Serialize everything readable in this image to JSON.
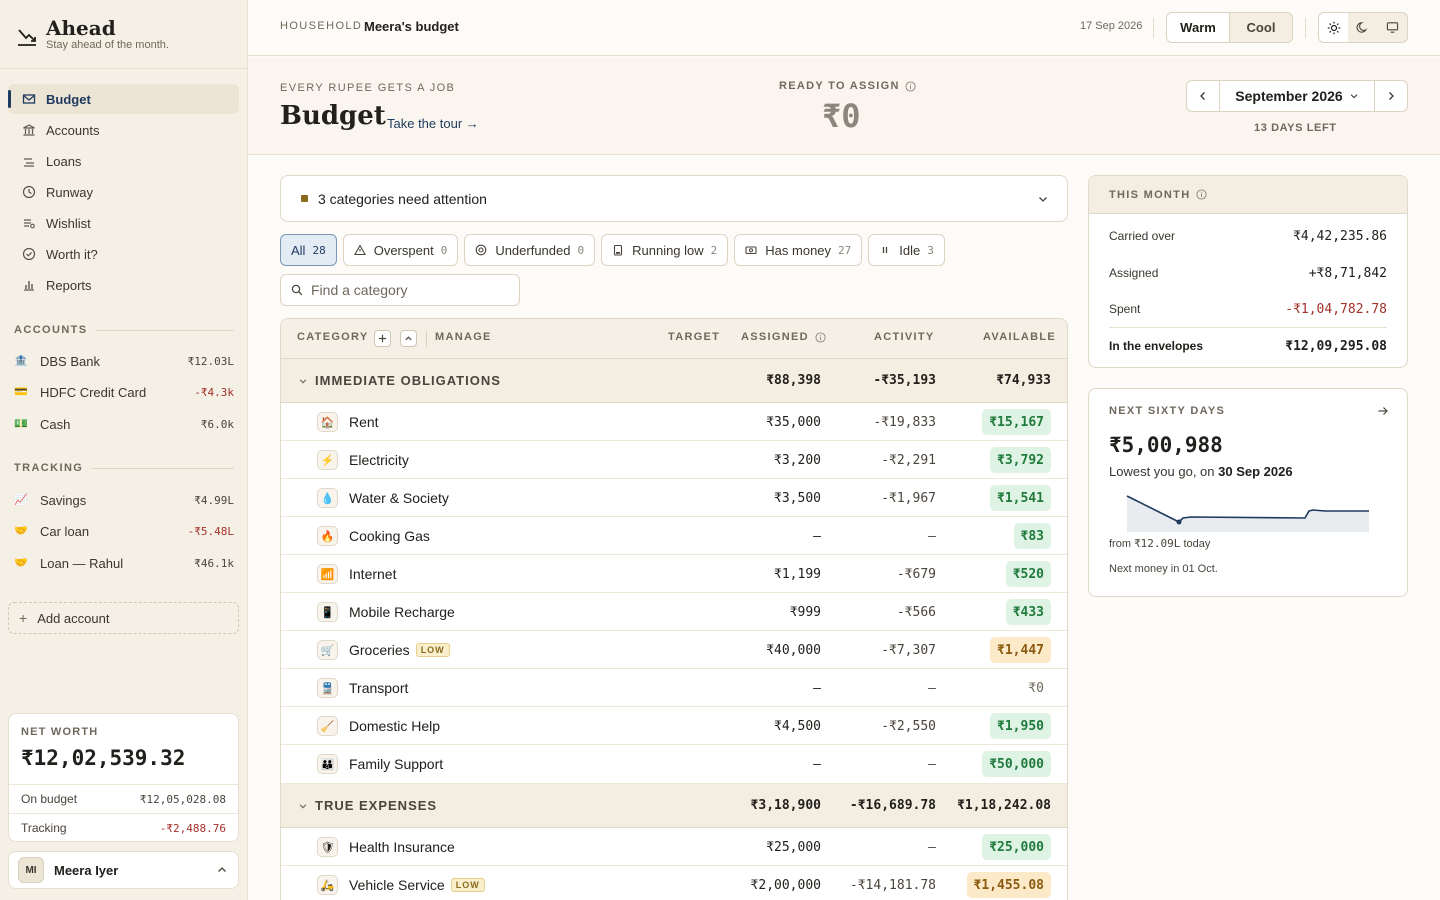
{
  "brand": {
    "title": "Ahead",
    "tagline": "Stay ahead of the month."
  },
  "nav": [
    {
      "label": "Budget",
      "icon": "envelope-icon",
      "active": true
    },
    {
      "label": "Accounts",
      "icon": "bank-icon"
    },
    {
      "label": "Loans",
      "icon": "transfer-icon"
    },
    {
      "label": "Runway",
      "icon": "clock-icon"
    },
    {
      "label": "Wishlist",
      "icon": "list-icon"
    },
    {
      "label": "Worth it?",
      "icon": "check-circle-icon"
    },
    {
      "label": "Reports",
      "icon": "bar-chart-icon"
    }
  ],
  "accounts": {
    "heading": "ACCOUNTS",
    "items": [
      {
        "name": "DBS Bank",
        "value": "₹12.03L",
        "icon": "🏦",
        "negative": false
      },
      {
        "name": "HDFC Credit Card",
        "value": "-₹4.3k",
        "icon": "💳",
        "negative": true
      },
      {
        "name": "Cash",
        "value": "₹6.0k",
        "icon": "💵",
        "negative": false
      }
    ]
  },
  "tracking": {
    "heading": "TRACKING",
    "items": [
      {
        "name": "Savings",
        "value": "₹4.99L",
        "icon": "📈",
        "negative": false
      },
      {
        "name": "Car loan",
        "value": "-₹5.48L",
        "icon": "🤝",
        "negative": true
      },
      {
        "name": "Loan — Rahul",
        "value": "₹46.1k",
        "icon": "🤝",
        "negative": false
      }
    ]
  },
  "add_account": "Add account",
  "networth": {
    "label": "NET WORTH",
    "value": "₹12,02,539.32",
    "on_budget_label": "On budget",
    "on_budget_value": "₹12,05,028.08",
    "tracking_label": "Tracking",
    "tracking_value": "-₹2,488.76"
  },
  "user": {
    "initials": "MI",
    "name": "Meera Iyer"
  },
  "topbar": {
    "household_label": "HOUSEHOLD",
    "household_name": "Meera's budget",
    "date": "17 Sep 2026",
    "theme_options": [
      "Warm",
      "Cool"
    ],
    "theme_selected": "Warm"
  },
  "header": {
    "eyebrow": "EVERY RUPEE GETS A JOB",
    "title": "Budget",
    "tour": "Take the tour →",
    "rta_label": "READY TO ASSIGN",
    "rta_value": "₹0",
    "month": "September 2026",
    "days_left": "13 DAYS LEFT"
  },
  "attention": "3 categories need attention",
  "filters": [
    {
      "label": "All",
      "count": "28",
      "active": true
    },
    {
      "label": "Overspent",
      "count": "0"
    },
    {
      "label": "Underfunded",
      "count": "0"
    },
    {
      "label": "Running low",
      "count": "2"
    },
    {
      "label": "Has money",
      "count": "27"
    },
    {
      "label": "Idle",
      "count": "3"
    }
  ],
  "search": {
    "placeholder": "Find a category"
  },
  "table": {
    "headers": {
      "category": "CATEGORY",
      "manage": "MANAGE",
      "target": "TARGET",
      "assigned": "ASSIGNED",
      "activity": "ACTIVITY",
      "available": "AVAILABLE"
    },
    "groups": [
      {
        "name": "IMMEDIATE OBLIGATIONS",
        "assigned": "₹88,398",
        "activity": "-₹35,193",
        "available": "₹74,933",
        "rows": [
          {
            "icon": "🏠",
            "name": "Rent",
            "assigned": "₹35,000",
            "activity": "-₹19,833",
            "available": "₹15,167",
            "status": "pos"
          },
          {
            "icon": "⚡",
            "name": "Electricity",
            "assigned": "₹3,200",
            "activity": "-₹2,291",
            "available": "₹3,792",
            "status": "pos"
          },
          {
            "icon": "💧",
            "name": "Water & Society",
            "assigned": "₹3,500",
            "activity": "-₹1,967",
            "available": "₹1,541",
            "status": "pos"
          },
          {
            "icon": "🔥",
            "name": "Cooking Gas",
            "assigned": "–",
            "activity": "–",
            "available": "₹83",
            "status": "pos"
          },
          {
            "icon": "📶",
            "name": "Internet",
            "assigned": "₹1,199",
            "activity": "-₹679",
            "available": "₹520",
            "status": "pos"
          },
          {
            "icon": "📱",
            "name": "Mobile Recharge",
            "assigned": "₹999",
            "activity": "-₹566",
            "available": "₹433",
            "status": "pos"
          },
          {
            "icon": "🛒",
            "name": "Groceries",
            "badge": "LOW",
            "assigned": "₹40,000",
            "activity": "-₹7,307",
            "available": "₹1,447",
            "status": "low"
          },
          {
            "icon": "🚆",
            "name": "Transport",
            "assigned": "–",
            "activity": "–",
            "available": "₹0",
            "status": "zero"
          },
          {
            "icon": "🧹",
            "name": "Domestic Help",
            "assigned": "₹4,500",
            "activity": "-₹2,550",
            "available": "₹1,950",
            "status": "pos"
          },
          {
            "icon": "👪",
            "name": "Family Support",
            "assigned": "–",
            "activity": "–",
            "available": "₹50,000",
            "status": "pos"
          }
        ]
      },
      {
        "name": "TRUE EXPENSES",
        "assigned": "₹3,18,900",
        "activity": "-₹16,689.78",
        "available": "₹1,18,242.08",
        "rows": [
          {
            "icon": "🛡",
            "name": "Health Insurance",
            "assigned": "₹25,000",
            "activity": "–",
            "available": "₹25,000",
            "status": "pos"
          },
          {
            "icon": "🛵",
            "name": "Vehicle Service",
            "badge": "LOW",
            "assigned": "₹2,00,000",
            "activity": "-₹14,181.78",
            "available": "₹1,455.08",
            "status": "low"
          }
        ]
      }
    ]
  },
  "this_month": {
    "heading": "THIS MONTH",
    "carried_label": "Carried over",
    "carried_value": "₹4,42,235.86",
    "assigned_label": "Assigned",
    "assigned_value": "+₹8,71,842",
    "spent_label": "Spent",
    "spent_value": "-₹1,04,782.78",
    "env_label": "In the envelopes",
    "env_value": "₹12,09,295.08"
  },
  "next_sixty": {
    "heading": "NEXT SIXTY DAYS",
    "value": "₹5,00,988",
    "lowest_prefix": "Lowest you go, on",
    "lowest_date": "30 Sep 2026",
    "from_prefix": "from",
    "from_value": "₹12.09L",
    "from_suffix": "today",
    "next_prefix": "Next money in",
    "next_date": "01 Oct."
  }
}
